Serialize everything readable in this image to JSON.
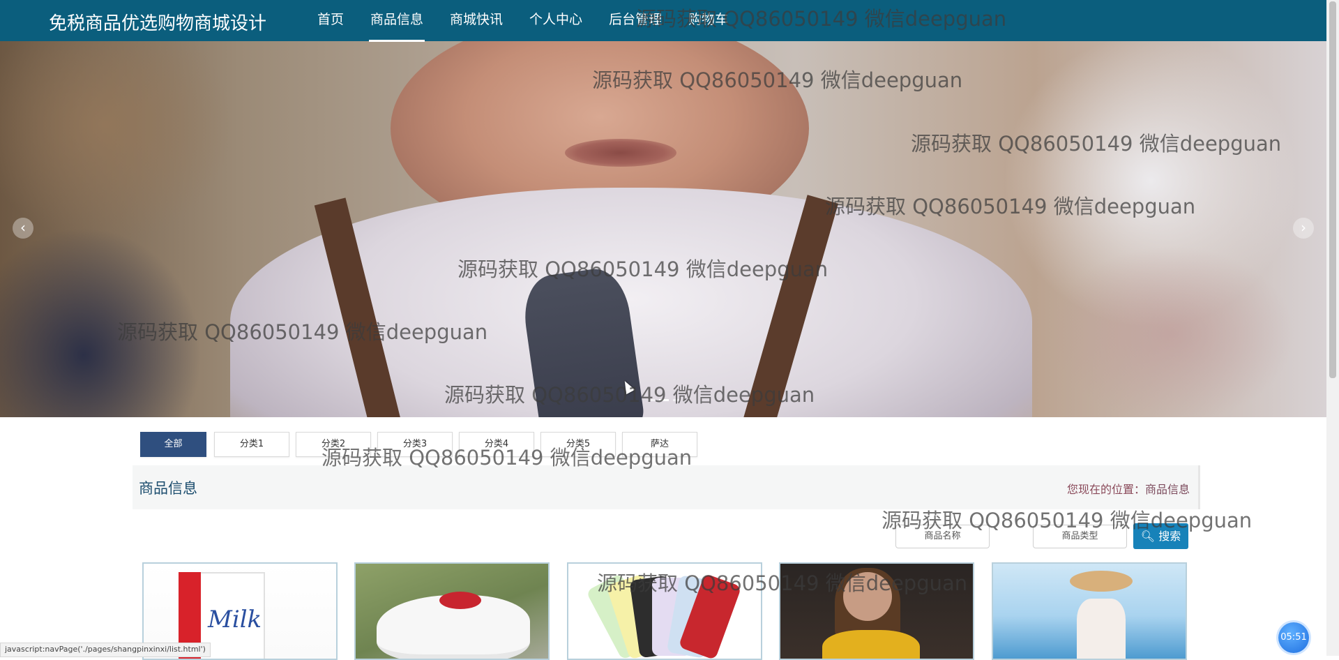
{
  "brand": "免税商品优选购物商城设计",
  "nav": [
    "首页",
    "商品信息",
    "商城快讯",
    "个人中心",
    "后台管理",
    "购物车"
  ],
  "nav_active_index": 1,
  "banner": {
    "prev_icon": "chevron-left-icon",
    "next_icon": "chevron-right-icon",
    "slide_count": 3,
    "active_slide": 1
  },
  "categories": [
    "全部",
    "分类1",
    "分类2",
    "分类3",
    "分类4",
    "分类5",
    "萨达"
  ],
  "section": {
    "title": "商品信息",
    "crumb_prefix": "您现在的位置：",
    "crumb_current": "商品信息"
  },
  "search": {
    "name_placeholder": "商品名称",
    "type_placeholder": "商品类型",
    "button_label": "搜索",
    "button_icon": "search-icon"
  },
  "watermark": "源码获取 QQ86050149 微信deepguan",
  "statusbar": "javascript:navPage('./pages/shangpinxinxi/list.html')",
  "timer": "05:51",
  "colors": {
    "nav_bg": "#0b5e7d",
    "active_tab": "#2f4f7f",
    "search_button": "#1782b9",
    "section_title": "#1c4d6e"
  }
}
